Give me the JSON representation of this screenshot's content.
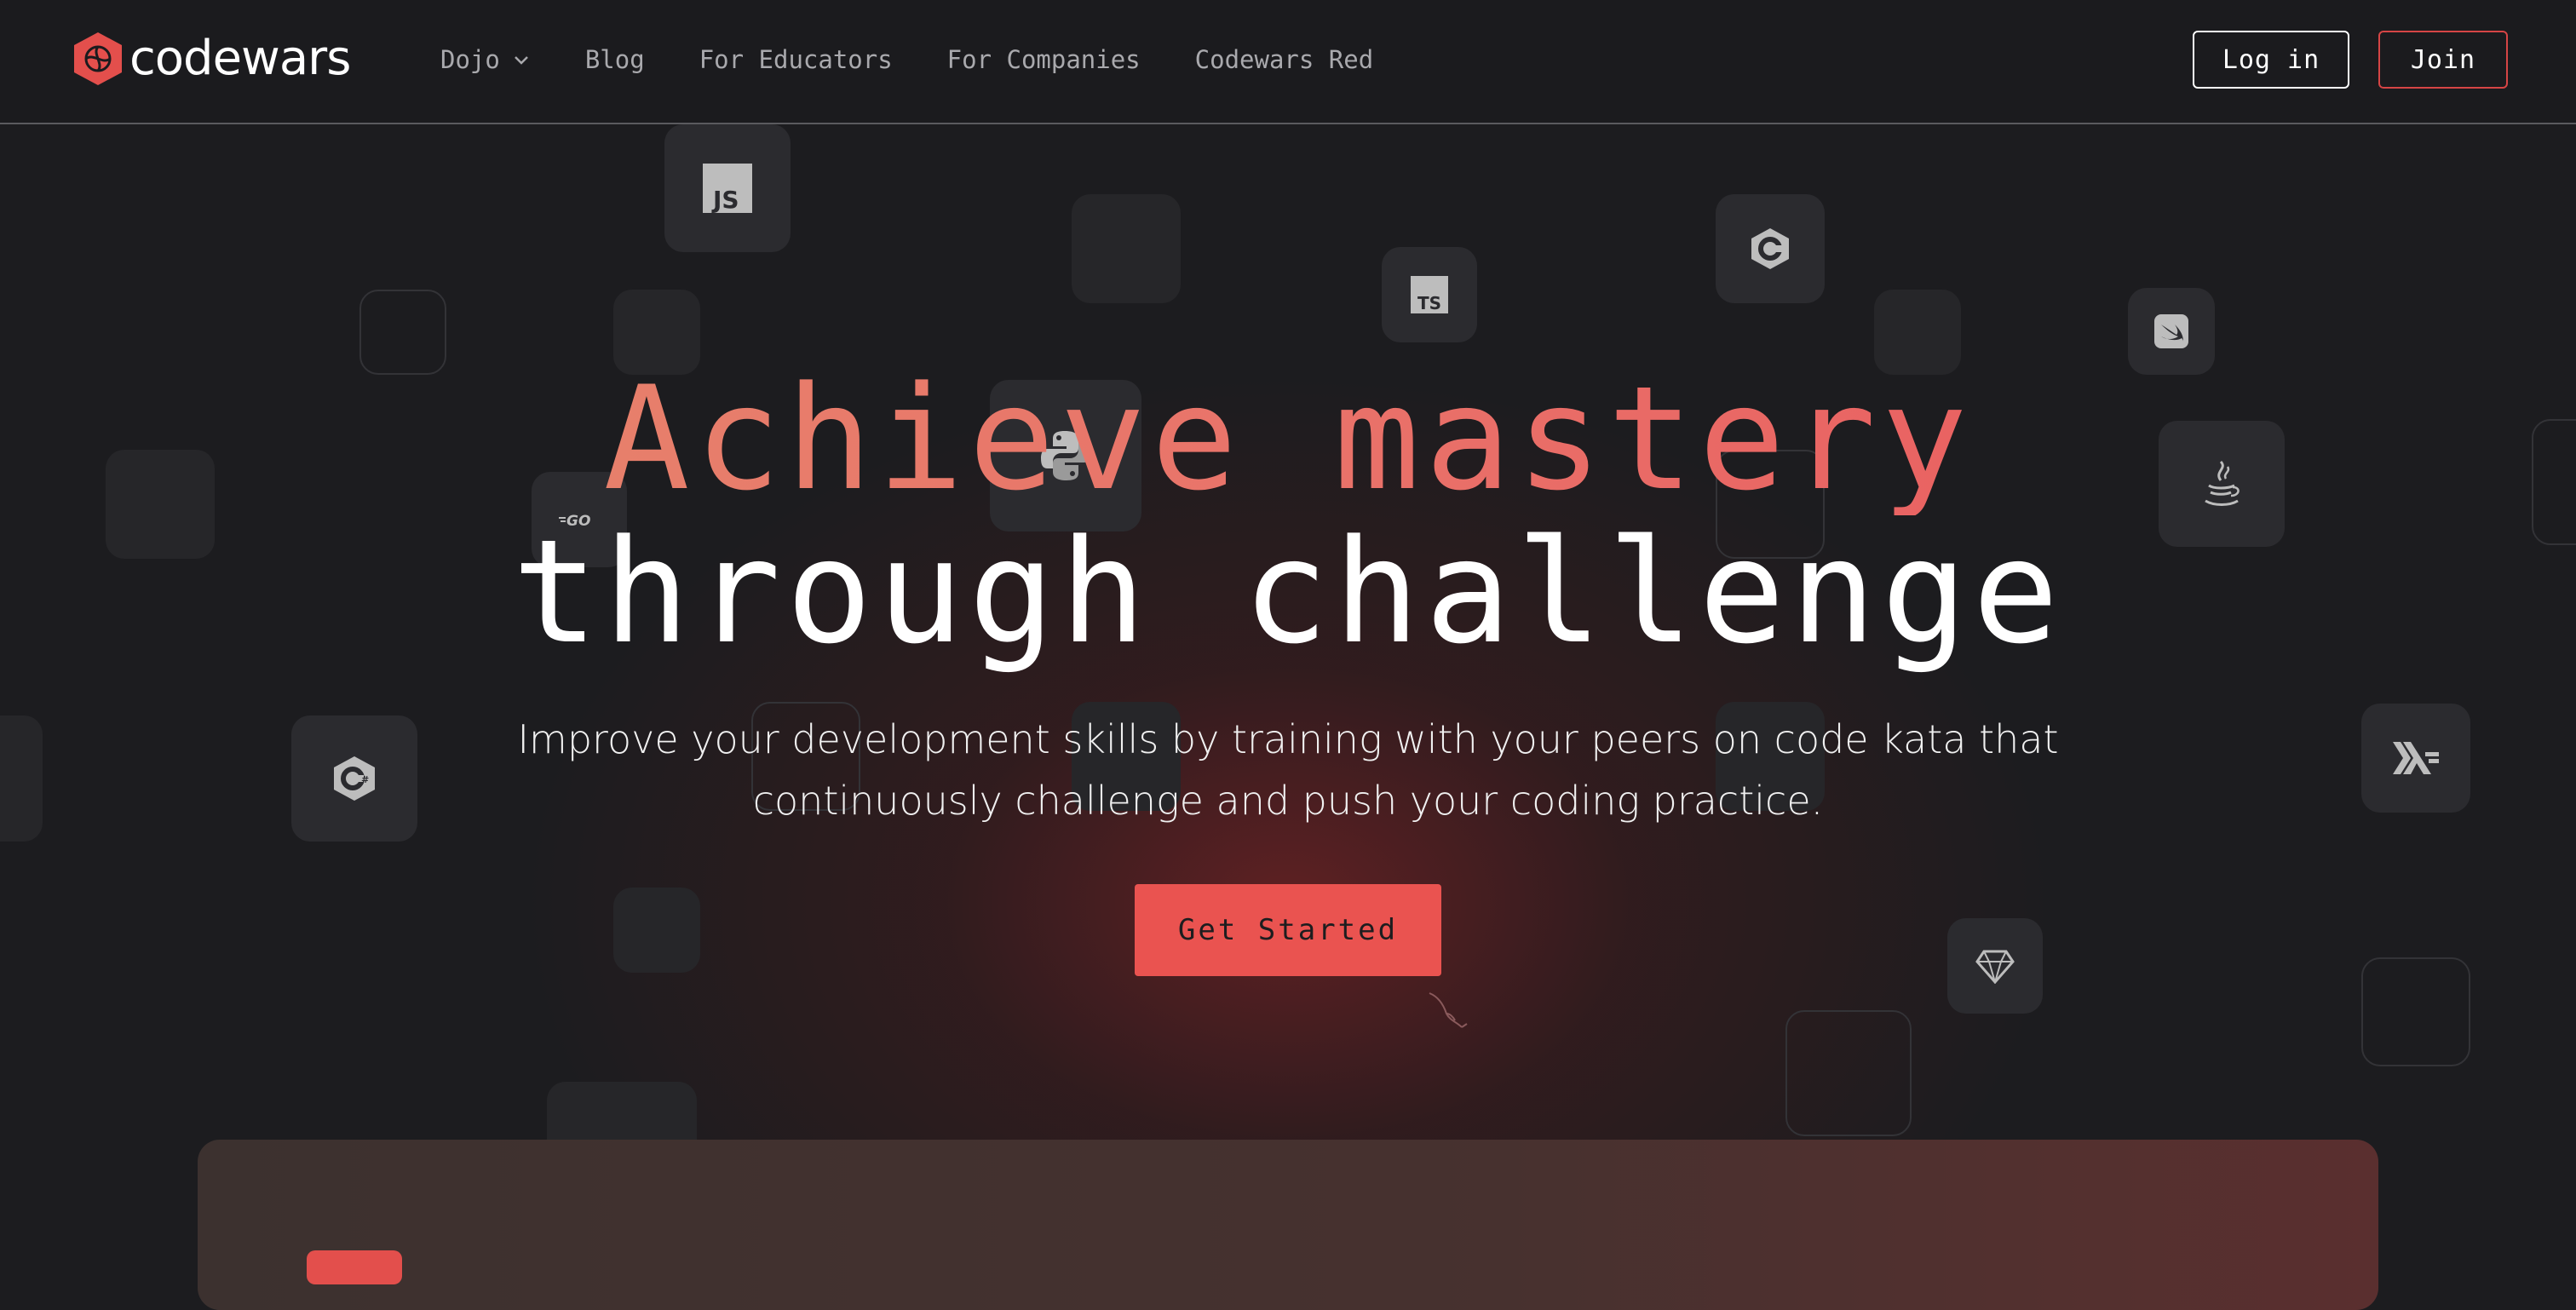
{
  "brand": {
    "name": "codewars",
    "accent": "#e34f4c"
  },
  "nav": {
    "links": [
      {
        "label": "Dojo",
        "has_dropdown": true
      },
      {
        "label": "Blog"
      },
      {
        "label": "For Educators"
      },
      {
        "label": "For Companies"
      },
      {
        "label": "Codewars Red"
      }
    ],
    "login_label": "Log in",
    "join_label": "Join"
  },
  "hero": {
    "title_line1": "Achieve mastery",
    "title_line2": "through challenge",
    "subtitle": "Improve your development skills by training with your peers on code kata that continuously challenge and push your coding practice.",
    "cta_label": "Get Started"
  },
  "language_icons": [
    "javascript-icon",
    "typescript-icon",
    "c-icon",
    "swift-icon",
    "python-icon",
    "go-icon",
    "java-icon",
    "csharp-icon",
    "haskell-icon",
    "ruby-icon",
    "mysql-icon"
  ],
  "colors": {
    "background": "#1c1c1f",
    "title_gradient": [
      "#e58a6c",
      "#e9545b"
    ],
    "cta": "#ea5350"
  }
}
